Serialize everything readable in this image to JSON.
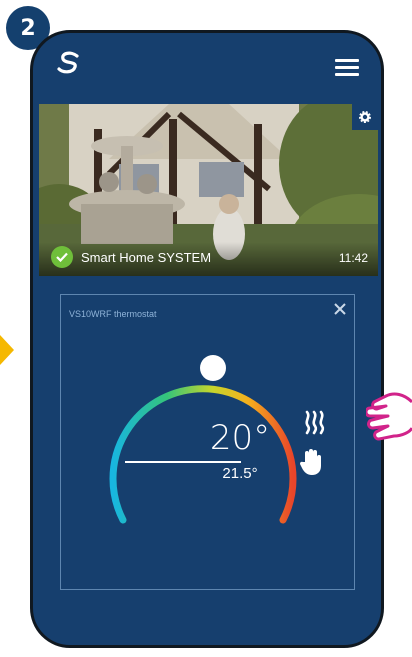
{
  "step_badge": "2",
  "app": {
    "logo": "salus-logo-icon",
    "menu": "hamburger-menu-icon"
  },
  "scene": {
    "title": "Smart Home SYSTEM",
    "time": "11:42",
    "status": "connected-check-icon",
    "settings": "gear-icon"
  },
  "thermostat": {
    "name": "VS10WRF thermostat",
    "setpoint": "20°",
    "current": "21.5°",
    "icons": [
      "heating-icon",
      "manual-mode-hand-icon",
      "close-icon"
    ]
  },
  "colors": {
    "background": "#163f6e",
    "accent_green": "#6fbf3a",
    "hand_pointer": "#d1238a"
  }
}
